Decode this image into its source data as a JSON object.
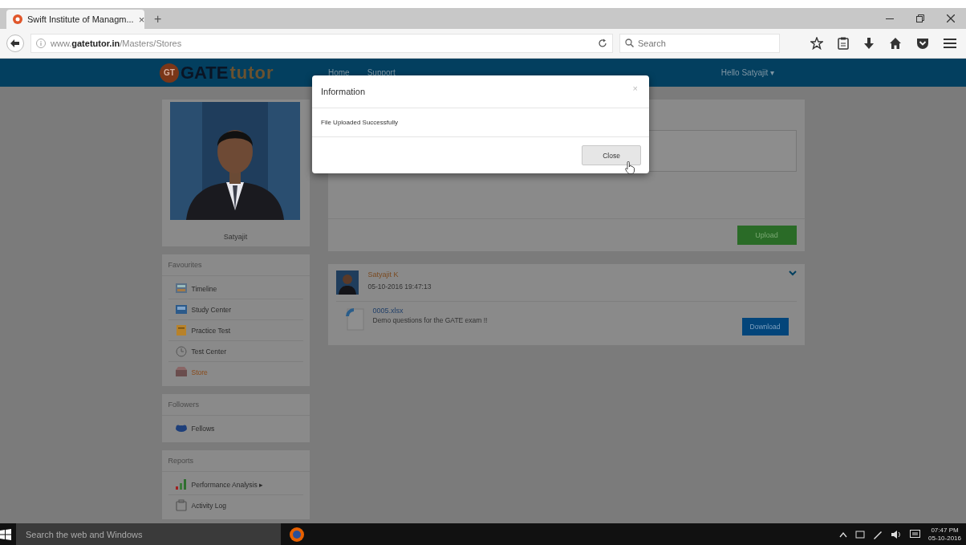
{
  "browser": {
    "tab": {
      "title": "Swift Institute of Managm...",
      "close": "×"
    },
    "new_tab": "+",
    "address": "www.**gatetutor.in**/Masters/Stores",
    "search": {
      "placeholder": "Search"
    }
  },
  "site": {
    "logo": {
      "mark": "GT",
      "word_a": "GATE",
      "word_b": "tutor"
    },
    "nav": [
      "Home",
      "Support"
    ],
    "user_menu": "Hello Satyajit ▾"
  },
  "profile": {
    "name": "Satyajit"
  },
  "sidebar": [
    {
      "heading": "Favourites",
      "items": [
        {
          "label": "Timeline",
          "selected": false
        },
        {
          "label": "Study Center",
          "selected": false
        },
        {
          "label": "Practice Test",
          "selected": false
        },
        {
          "label": "Test Center",
          "selected": false
        },
        {
          "label": "Store",
          "selected": true
        }
      ]
    },
    {
      "heading": "Followers",
      "items": [
        {
          "label": "Fellows",
          "selected": false
        }
      ]
    },
    {
      "heading": "Reports",
      "items": [
        {
          "label": "Performance Analysis ▸",
          "selected": false
        },
        {
          "label": "Activity Log",
          "selected": false
        }
      ]
    }
  ],
  "upload": {
    "button": "Upload"
  },
  "post": {
    "author": "Satyajit K",
    "time": "05-10-2016 19:47:13",
    "file": "0005.xlsx",
    "description": "Demo questions for the GATE exam !!",
    "button": "Download"
  },
  "modal": {
    "title": "Information",
    "close": "×",
    "message": "File Uploaded Successfully",
    "button": "Close"
  },
  "taskbar": {
    "search": "Search the web and Windows",
    "time": "07:47 PM",
    "date": "05-10-2016"
  }
}
